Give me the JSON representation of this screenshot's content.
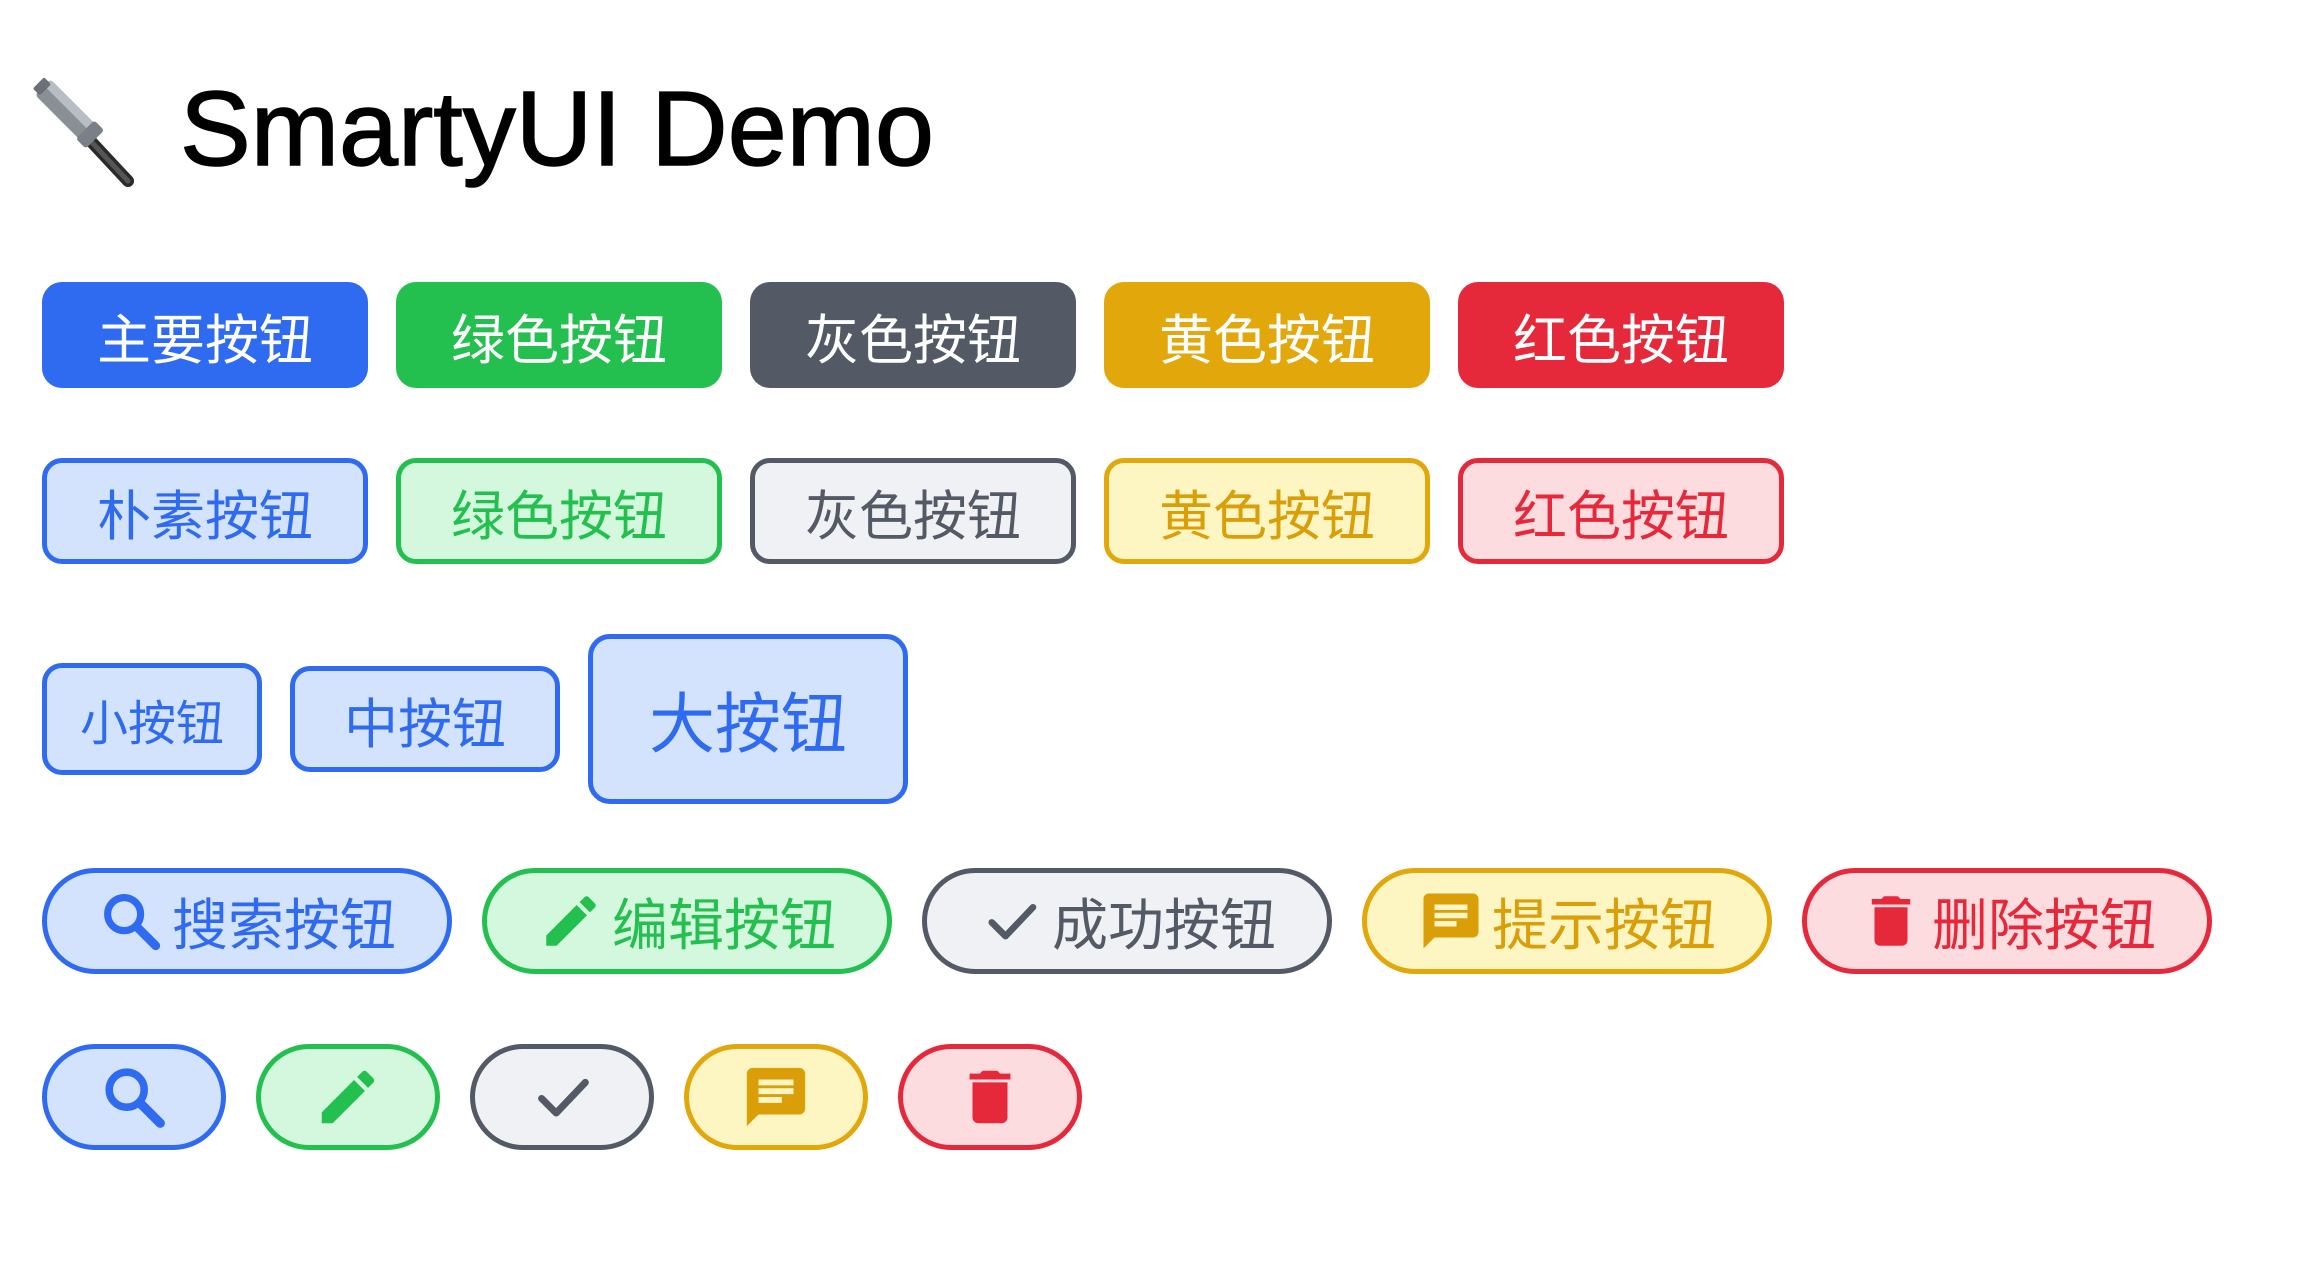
{
  "title": {
    "icon": "hammer-icon",
    "text": "SmartyUI Demo"
  },
  "solid_buttons": [
    {
      "label": "主要按钮",
      "color": "#2f6bf0"
    },
    {
      "label": "绿色按钮",
      "color": "#23bf4f"
    },
    {
      "label": "灰色按钮",
      "color": "#535a66"
    },
    {
      "label": "黄色按钮",
      "color": "#e1a70b"
    },
    {
      "label": "红色按钮",
      "color": "#e6293a"
    }
  ],
  "plain_buttons": [
    {
      "label": "朴素按钮",
      "color": "#2f6bf0"
    },
    {
      "label": "绿色按钮",
      "color": "#23bf4f"
    },
    {
      "label": "灰色按钮",
      "color": "#535a66"
    },
    {
      "label": "黄色按钮",
      "color": "#e1a70b"
    },
    {
      "label": "红色按钮",
      "color": "#e6293a"
    }
  ],
  "size_buttons": [
    {
      "label": "小按钮",
      "size": "small"
    },
    {
      "label": "中按钮",
      "size": "medium"
    },
    {
      "label": "大按钮",
      "size": "large"
    }
  ],
  "icon_text_buttons": [
    {
      "label": "搜索按钮",
      "icon": "search-icon",
      "color": "#2f6bf0"
    },
    {
      "label": "编辑按钮",
      "icon": "pencil-icon",
      "color": "#23bf4f"
    },
    {
      "label": "成功按钮",
      "icon": "check-icon",
      "color": "#535a66"
    },
    {
      "label": "提示按钮",
      "icon": "message-icon",
      "color": "#e1a70b"
    },
    {
      "label": "删除按钮",
      "icon": "trash-icon",
      "color": "#e6293a"
    }
  ],
  "icon_only_buttons": [
    {
      "icon": "search-icon",
      "color": "#2f6bf0"
    },
    {
      "icon": "pencil-icon",
      "color": "#23bf4f"
    },
    {
      "icon": "check-icon",
      "color": "#535a66"
    },
    {
      "icon": "message-icon",
      "color": "#e1a70b"
    },
    {
      "icon": "trash-icon",
      "color": "#e6293a"
    }
  ]
}
